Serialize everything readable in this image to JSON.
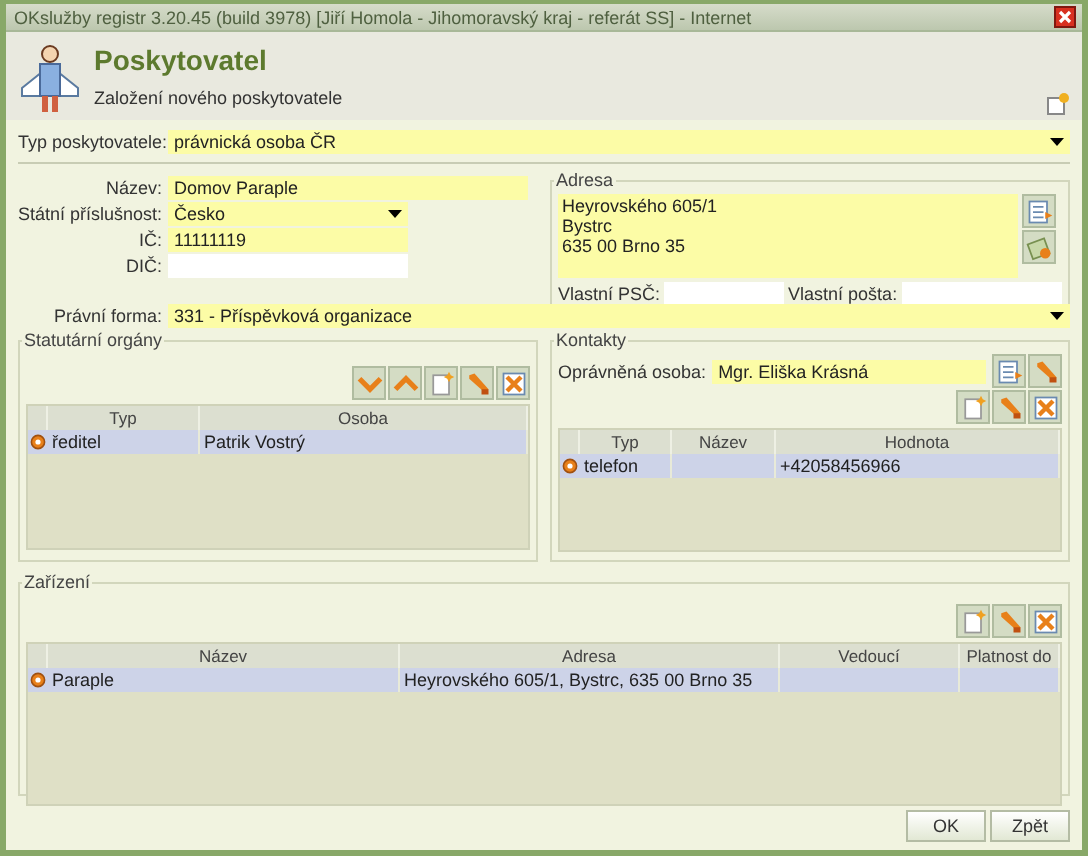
{
  "window": {
    "title": "OKslužby registr 3.20.45 (build 3978) [Jiří Homola - Jihomoravský kraj - referát SS] - Internet"
  },
  "header": {
    "title": "Poskytovatel",
    "subtitle": "Založení nového poskytovatele"
  },
  "provider_type": {
    "label": "Typ poskytovatele:",
    "value": "právnická osoba ČR"
  },
  "fields": [
    {
      "label": "Název:",
      "value": "Domov Paraple",
      "kind": "text"
    },
    {
      "label": "Státní příslušnost:",
      "value": "Česko",
      "kind": "select"
    },
    {
      "label": "IČ:",
      "value": "11111119",
      "kind": "text"
    },
    {
      "label": "DIČ:",
      "kind": "text"
    }
  ],
  "address": {
    "legend": "Adresa",
    "lines": [
      "Heyrovského 605/1",
      "Bystrc",
      "635 00 Brno 35"
    ],
    "own_zip_label": "Vlastní PSČ:",
    "own_post_label": "Vlastní pošta:"
  },
  "legal_form": {
    "label": "Právní forma:",
    "value": "331 - Příspěvková organizace"
  },
  "statutory": {
    "legend": "Statutární orgány",
    "columns": [
      "Typ",
      "Osoba"
    ],
    "rows": [
      {
        "cells": [
          "ředitel",
          "Patrik Vostrý"
        ],
        "selected": true
      }
    ]
  },
  "contacts": {
    "legend": "Kontakty",
    "person_label": "Oprávněná osoba:",
    "person": "Mgr. Eliška Krásná",
    "columns": [
      "Typ",
      "Název",
      "Hodnota"
    ],
    "rows": [
      {
        "cells": [
          "telefon",
          null,
          "+42058456966"
        ],
        "selected": true
      }
    ]
  },
  "facilities": {
    "legend": "Zařízení",
    "columns": [
      "Název",
      "Adresa",
      "Vedoucí",
      "Platnost do"
    ],
    "rows": [
      {
        "cells": [
          "Paraple",
          "Heyrovského 605/1, Bystrc, 635 00 Brno 35",
          null,
          null
        ],
        "selected": true
      }
    ]
  },
  "buttons": [
    "OK",
    "Zpět"
  ]
}
